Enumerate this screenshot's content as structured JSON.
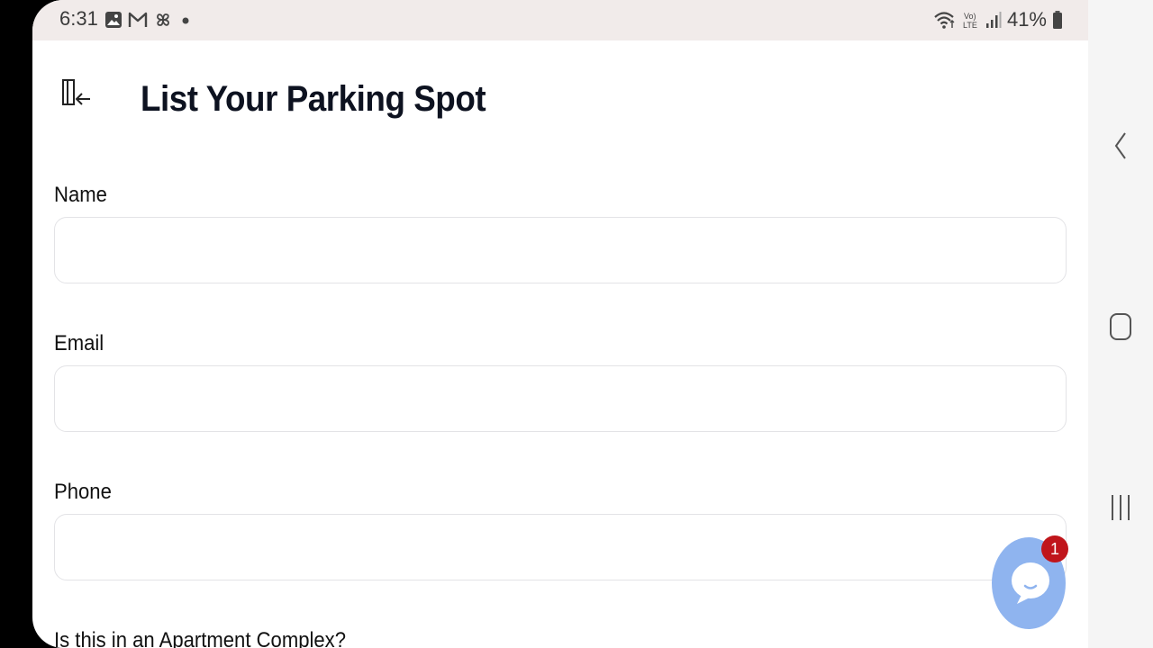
{
  "status_bar": {
    "time": "6:31",
    "battery": "41%",
    "left_icons": [
      "gallery-icon",
      "gmail-icon",
      "pinwheel-icon",
      "dot-icon"
    ],
    "right_icons": [
      "wifi-icon",
      "volte-icon",
      "signal-icon",
      "battery-icon"
    ]
  },
  "header": {
    "title": "List Your Parking Spot",
    "menu_icon": "collapse-sidebar-icon"
  },
  "form": {
    "name_label": "Name",
    "name_value": "",
    "email_label": "Email",
    "email_value": "",
    "phone_label": "Phone",
    "phone_value": "",
    "apartment_label": "Is this in an Apartment Complex?"
  },
  "chat": {
    "badge_count": "1",
    "icon": "chat-icon"
  },
  "navigation": {
    "back_icon": "back-icon",
    "home_icon": "home-icon",
    "recents_icon": "recents-icon"
  },
  "colors": {
    "title": "#0d1220",
    "status_bar_bg": "#f1ebea",
    "chat_fab": "#8fb4ef",
    "badge": "#c0151b",
    "input_border": "#e3e3e6"
  }
}
